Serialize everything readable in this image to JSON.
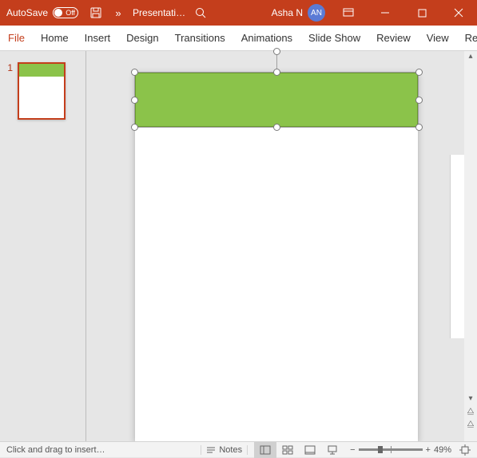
{
  "title_bar": {
    "autosave_label": "AutoSave",
    "autosave_state": "Off",
    "doc_title": "Presentati…",
    "user_name": "Asha N",
    "user_initials": "AN"
  },
  "ribbon": {
    "tabs": [
      "File",
      "Home",
      "Insert",
      "Design",
      "Transitions",
      "Animations",
      "Slide Show",
      "Review",
      "View",
      "Recordi"
    ]
  },
  "thumbnails": {
    "items": [
      {
        "number": "1"
      }
    ]
  },
  "status": {
    "message": "Click and drag to insert…",
    "notes_label": "Notes",
    "zoom_pct": "49%"
  },
  "colors": {
    "accent": "#c43e1c",
    "shape_fill": "#8bc34a"
  }
}
